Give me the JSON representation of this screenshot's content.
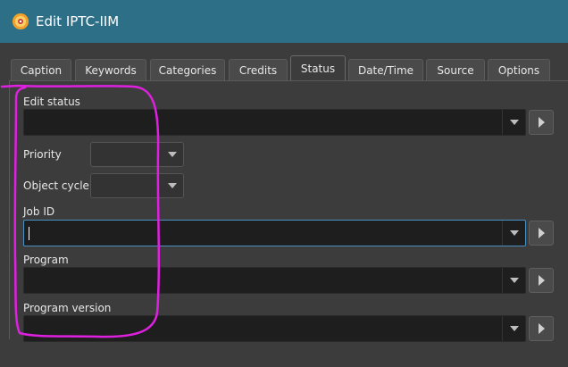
{
  "window": {
    "title": "Edit IPTC-IIM",
    "icon": "digikam-app-icon"
  },
  "tabs": [
    {
      "label": "Caption",
      "active": false
    },
    {
      "label": "Keywords",
      "active": false
    },
    {
      "label": "Categories",
      "active": false
    },
    {
      "label": "Credits",
      "active": false
    },
    {
      "label": "Status",
      "active": true
    },
    {
      "label": "Date/Time",
      "active": false
    },
    {
      "label": "Source",
      "active": false
    },
    {
      "label": "Options",
      "active": false
    }
  ],
  "status": {
    "edit_status": {
      "label": "Edit status",
      "value": ""
    },
    "priority": {
      "label": "Priority",
      "value": ""
    },
    "object_cycle": {
      "label": "Object cycle",
      "value": ""
    },
    "job_id": {
      "label": "Job ID",
      "value": ""
    },
    "program": {
      "label": "Program",
      "value": ""
    },
    "program_version": {
      "label": "Program version",
      "value": ""
    }
  },
  "colors": {
    "titlebar": "#2d6f86",
    "background": "#3c3c3c",
    "field": "#1e1e1e",
    "focus": "#4a90c2",
    "annotation": "#e020e0"
  }
}
